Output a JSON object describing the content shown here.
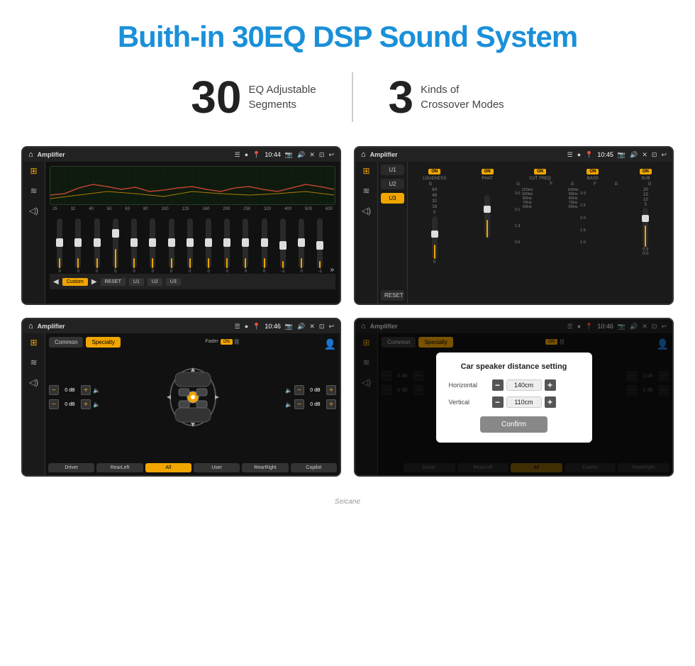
{
  "page": {
    "title": "Buith-in 30EQ DSP Sound System",
    "title_color": "#1a90d9"
  },
  "stats": [
    {
      "number": "30",
      "label_line1": "EQ Adjustable",
      "label_line2": "Segments"
    },
    {
      "number": "3",
      "label_line1": "Kinds of",
      "label_line2": "Crossover Modes"
    }
  ],
  "screens": [
    {
      "id": "eq-screen",
      "status_bar": {
        "title": "Amplifier",
        "time": "10:44"
      },
      "eq_labels": [
        "25",
        "32",
        "40",
        "50",
        "63",
        "80",
        "100",
        "125",
        "160",
        "200",
        "250",
        "320",
        "400",
        "500",
        "630"
      ],
      "eq_sliders": [
        0,
        0,
        0,
        5,
        0,
        0,
        0,
        0,
        0,
        0,
        0,
        0,
        -1,
        0,
        -1
      ],
      "bottom_buttons": [
        "Custom",
        "RESET",
        "U1",
        "U2",
        "U3"
      ]
    },
    {
      "id": "crossover-screen",
      "status_bar": {
        "title": "Amplifier",
        "time": "10:45"
      },
      "presets": [
        "U1",
        "U2",
        "U3"
      ],
      "active_preset": "U3",
      "channels": [
        {
          "name": "LOUDNESS",
          "on": true
        },
        {
          "name": "PHAT",
          "on": true
        },
        {
          "name": "CUT FREQ",
          "on": true
        },
        {
          "name": "BASS",
          "on": true
        },
        {
          "name": "SUB",
          "on": true
        }
      ],
      "reset_label": "RESET"
    },
    {
      "id": "specialty-screen",
      "status_bar": {
        "title": "Amplifier",
        "time": "10:46"
      },
      "tabs": [
        "Common",
        "Specialty"
      ],
      "active_tab": "Specialty",
      "fader_label": "Fader",
      "fader_on": "ON",
      "speaker_settings": {
        "front_left_db": "0 dB",
        "front_right_db": "0 dB",
        "rear_left_db": "0 dB",
        "rear_right_db": "0 dB"
      },
      "bottom_buttons": [
        "Driver",
        "RearLeft",
        "All",
        "User",
        "RearRight",
        "Copilot"
      ],
      "active_bottom": "All"
    },
    {
      "id": "dialog-screen",
      "status_bar": {
        "title": "Amplifier",
        "time": "10:46"
      },
      "tabs": [
        "Common",
        "Specialty"
      ],
      "active_tab": "Specialty",
      "dialog": {
        "title": "Car speaker distance setting",
        "horizontal_label": "Horizontal",
        "horizontal_value": "140cm",
        "vertical_label": "Vertical",
        "vertical_value": "110cm",
        "confirm_label": "Confirm"
      },
      "bottom_buttons_left": [
        "Driver",
        "RearLeft"
      ],
      "bottom_highlight": "All",
      "bottom_buttons_right": [
        "Copilot",
        "RearRight"
      ]
    }
  ],
  "watermark": "Seicane"
}
